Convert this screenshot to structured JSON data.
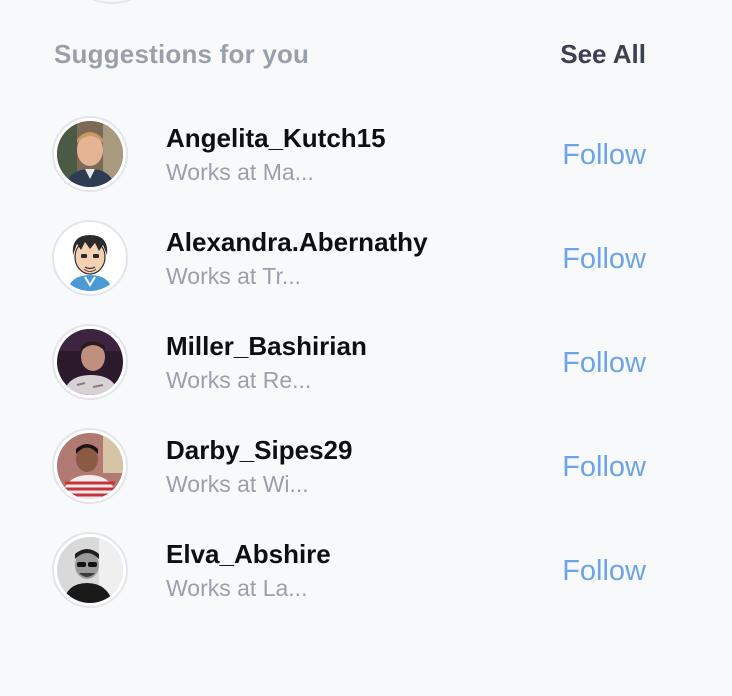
{
  "header": {
    "title": "Suggestions for you",
    "see_all": "See All"
  },
  "suggestions": [
    {
      "name": "Angelita_Kutch15",
      "subtitle": "Works at Ma...",
      "follow": "Follow"
    },
    {
      "name": "Alexandra.Abernathy",
      "subtitle": "Works at Tr...",
      "follow": "Follow"
    },
    {
      "name": "Miller_Bashirian",
      "subtitle": "Works at Re...",
      "follow": "Follow"
    },
    {
      "name": "Darby_Sipes29",
      "subtitle": "Works at Wi...",
      "follow": "Follow"
    },
    {
      "name": "Elva_Abshire",
      "subtitle": "Works at La...",
      "follow": "Follow"
    }
  ],
  "colors": {
    "background": "#f8f9fb",
    "follow_link": "#6ea3e8",
    "muted_text": "#9aa0ab"
  }
}
